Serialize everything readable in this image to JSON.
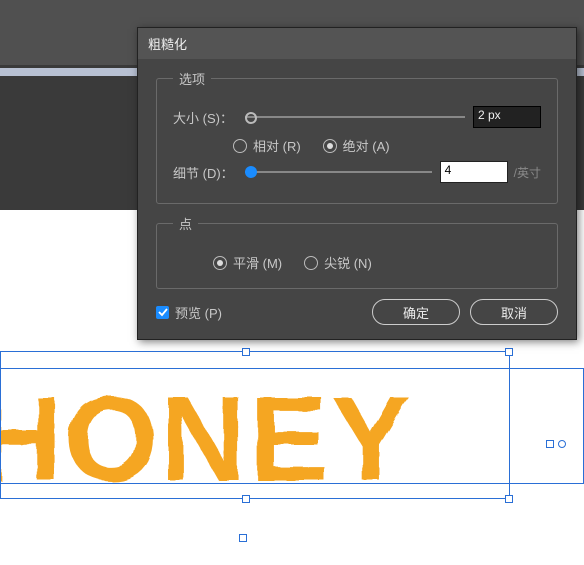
{
  "dialog": {
    "title": "粗糙化",
    "options_legend": "选项",
    "size_label": "大小 (S)：",
    "size_value": "2 px",
    "relative_label": "相对 (R)",
    "absolute_label": "绝对 (A)",
    "size_mode": "absolute",
    "detail_label": "细节 (D)：",
    "detail_value": "4",
    "detail_unit": "/英寸",
    "points_legend": "点",
    "smooth_label": "平滑 (M)",
    "sharp_label": "尖锐 (N)",
    "points_mode": "smooth",
    "preview_label": "预览 (P)",
    "preview_checked": true,
    "ok_label": "确定",
    "cancel_label": "取消"
  },
  "artwork": {
    "text": "HONEY",
    "color": "#f5a623"
  }
}
